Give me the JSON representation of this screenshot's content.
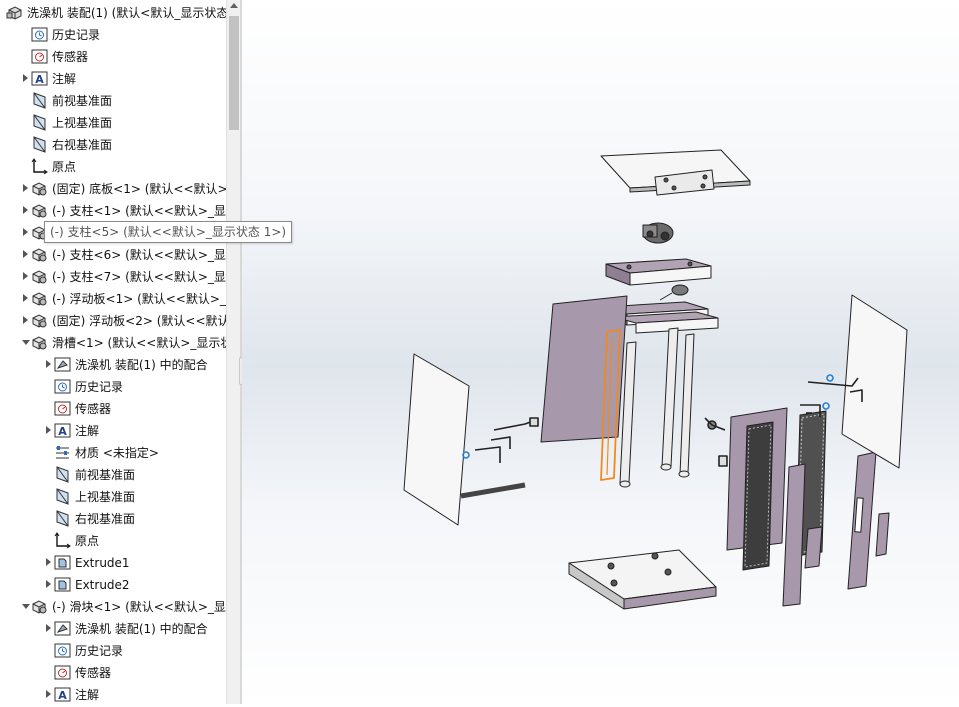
{
  "tree": {
    "rows": [
      {
        "label": "洗澡机 装配(1)  (默认<默认_显示状态",
        "icon": "assembly-icon",
        "indent": 0,
        "arrow": "none",
        "name": "tree-root-assembly"
      },
      {
        "label": "历史记录",
        "icon": "history-icon",
        "indent": 1,
        "arrow": "none",
        "name": "tree-item-history"
      },
      {
        "label": "传感器",
        "icon": "sensor-icon",
        "indent": 1,
        "arrow": "none",
        "name": "tree-item-sensors"
      },
      {
        "label": "注解",
        "icon": "annotation-icon",
        "indent": 1,
        "arrow": "collapsed",
        "name": "tree-item-annotations"
      },
      {
        "label": "前视基准面",
        "icon": "plane-icon",
        "indent": 1,
        "arrow": "none",
        "name": "tree-item-front-plane"
      },
      {
        "label": "上视基准面",
        "icon": "plane-icon",
        "indent": 1,
        "arrow": "none",
        "name": "tree-item-top-plane"
      },
      {
        "label": "右视基准面",
        "icon": "plane-icon",
        "indent": 1,
        "arrow": "none",
        "name": "tree-item-right-plane"
      },
      {
        "label": "原点",
        "icon": "origin-icon",
        "indent": 1,
        "arrow": "none",
        "name": "tree-item-origin"
      },
      {
        "label": "(固定) 底板<1> (默认<<默认>_显",
        "icon": "part-icon",
        "indent": 1,
        "arrow": "collapsed",
        "name": "tree-item-base-plate"
      },
      {
        "label": "(-) 支柱<1> (默认<<默认>_显示",
        "icon": "part-icon",
        "indent": 1,
        "arrow": "collapsed",
        "name": "tree-item-pillar-1"
      },
      {
        "label": "",
        "icon": "part-icon",
        "indent": 1,
        "arrow": "collapsed",
        "name": "tree-item-pillar-5"
      },
      {
        "label": "(-) 支柱<6> (默认<<默认>_显示",
        "icon": "part-icon",
        "indent": 1,
        "arrow": "collapsed",
        "name": "tree-item-pillar-6"
      },
      {
        "label": "(-) 支柱<7> (默认<<默认>_显示",
        "icon": "part-icon",
        "indent": 1,
        "arrow": "collapsed",
        "name": "tree-item-pillar-7"
      },
      {
        "label": "(-) 浮动板<1> (默认<<默认>_显",
        "icon": "part-icon",
        "indent": 1,
        "arrow": "collapsed",
        "name": "tree-item-floating-plate-1"
      },
      {
        "label": "(固定) 浮动板<2> (默认<<默认>",
        "icon": "part-icon",
        "indent": 1,
        "arrow": "collapsed",
        "name": "tree-item-floating-plate-2"
      },
      {
        "label": "滑槽<1> (默认<<默认>_显示状态",
        "icon": "part-icon",
        "indent": 1,
        "arrow": "expanded",
        "name": "tree-item-chute-1"
      },
      {
        "label": "洗澡机 装配(1) 中的配合",
        "icon": "mates-icon",
        "indent": 2,
        "arrow": "collapsed",
        "name": "tree-item-chute-mates"
      },
      {
        "label": "历史记录",
        "icon": "history-icon",
        "indent": 2,
        "arrow": "none",
        "name": "tree-item-chute-history"
      },
      {
        "label": "传感器",
        "icon": "sensor-icon",
        "indent": 2,
        "arrow": "none",
        "name": "tree-item-chute-sensors"
      },
      {
        "label": "注解",
        "icon": "annotation-icon",
        "indent": 2,
        "arrow": "collapsed",
        "name": "tree-item-chute-annotations"
      },
      {
        "label": "材质 <未指定>",
        "icon": "material-icon",
        "indent": 2,
        "arrow": "none",
        "name": "tree-item-chute-material"
      },
      {
        "label": "前视基准面",
        "icon": "plane-icon",
        "indent": 2,
        "arrow": "none",
        "name": "tree-item-chute-front-plane"
      },
      {
        "label": "上视基准面",
        "icon": "plane-icon",
        "indent": 2,
        "arrow": "none",
        "name": "tree-item-chute-top-plane"
      },
      {
        "label": "右视基准面",
        "icon": "plane-icon",
        "indent": 2,
        "arrow": "none",
        "name": "tree-item-chute-right-plane"
      },
      {
        "label": "原点",
        "icon": "origin-icon",
        "indent": 2,
        "arrow": "none",
        "name": "tree-item-chute-origin"
      },
      {
        "label": "Extrude1",
        "icon": "extrude-icon",
        "indent": 2,
        "arrow": "collapsed",
        "name": "tree-item-extrude1"
      },
      {
        "label": "Extrude2",
        "icon": "extrude-icon",
        "indent": 2,
        "arrow": "collapsed",
        "name": "tree-item-extrude2"
      },
      {
        "label": "(-) 滑块<1> (默认<<默认>_显示",
        "icon": "part-icon",
        "indent": 1,
        "arrow": "expanded",
        "name": "tree-item-slider-1"
      },
      {
        "label": "洗澡机 装配(1) 中的配合",
        "icon": "mates-icon",
        "indent": 2,
        "arrow": "collapsed",
        "name": "tree-item-slider-mates"
      },
      {
        "label": "历史记录",
        "icon": "history-icon",
        "indent": 2,
        "arrow": "none",
        "name": "tree-item-slider-history"
      },
      {
        "label": "传感器",
        "icon": "sensor-icon",
        "indent": 2,
        "arrow": "none",
        "name": "tree-item-slider-sensors"
      },
      {
        "label": "注解",
        "icon": "annotation-icon",
        "indent": 2,
        "arrow": "collapsed",
        "name": "tree-item-slider-annotations"
      }
    ]
  },
  "tooltip": {
    "text": "(-) 支柱<5> (默认<<默认>_显示状态 1>)"
  },
  "colors": {
    "part_face": "#a898ab",
    "part_face_dark": "#8d7d90",
    "panel_white": "#f7f7f7",
    "edge": "#222222",
    "highlight": "#f08a1e"
  }
}
